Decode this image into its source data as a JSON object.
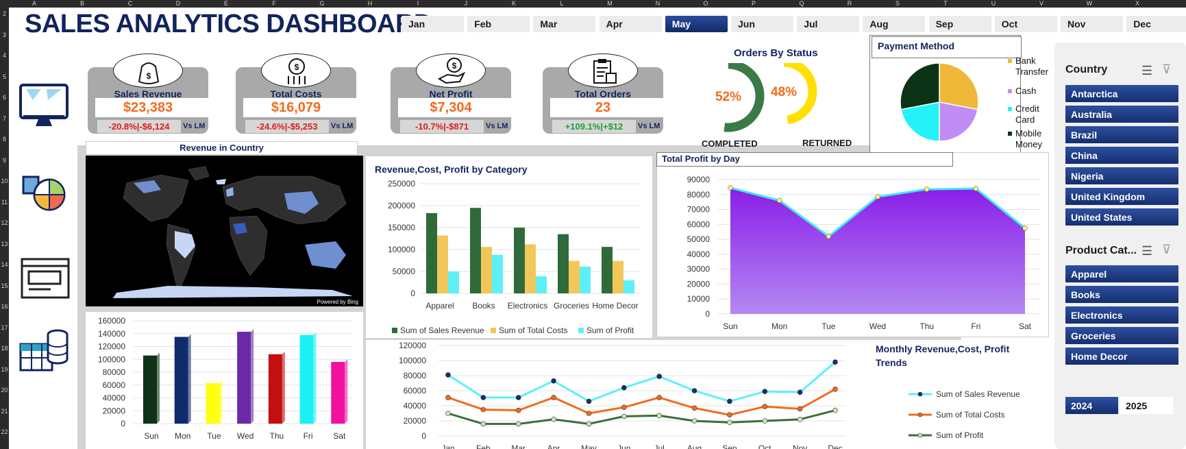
{
  "sheet": {
    "columns": [
      "A",
      "B",
      "C",
      "D",
      "E",
      "F",
      "G",
      "H",
      "I",
      "J",
      "K",
      "L",
      "M",
      "N",
      "O",
      "P",
      "Q",
      "R",
      "S",
      "T",
      "U",
      "V",
      "W",
      "X"
    ],
    "rows": [
      "2",
      "3",
      "4",
      "5",
      "6",
      "7",
      "8",
      "9",
      "10",
      "11",
      "12",
      "13",
      "14",
      "15",
      "16",
      "17",
      "18",
      "19",
      "20",
      "21",
      "22"
    ]
  },
  "title": "SALES ANALYTICS DASHBOARD",
  "months": [
    "Jan",
    "Feb",
    "Mar",
    "Apr",
    "May",
    "Jun",
    "Jul",
    "Aug",
    "Sep",
    "Oct",
    "Nov",
    "Dec"
  ],
  "selected_month": "May",
  "kpis": [
    {
      "label": "Sales Revenue",
      "value": "$23,383",
      "change": "-20.8%|-$6,124",
      "vs": "Vs LM",
      "trend": "neg",
      "icon": "money-bag-icon"
    },
    {
      "label": "Total Costs",
      "value": "$16,079",
      "change": "-24.6%|-$5,253",
      "vs": "Vs LM",
      "trend": "neg",
      "icon": "coin-down-icon"
    },
    {
      "label": "Net Profit",
      "value": "$7,304",
      "change": "-10.7%|-$871",
      "vs": "Vs LM",
      "trend": "neg",
      "icon": "hand-coin-icon"
    },
    {
      "label": "Total Orders",
      "value": "23",
      "change": "+109.1%|+$12",
      "vs": "Vs LM",
      "trend": "pos",
      "icon": "clipboard-box-icon"
    }
  ],
  "orders_status": {
    "title": "Orders By Status",
    "completed": {
      "pct": "52%",
      "label": "COMPLETED",
      "fraction": 0.52,
      "color": "#3a7a46"
    },
    "returned": {
      "pct": "48%",
      "label": "RETURNED",
      "fraction": 0.48,
      "color": "#ffe000"
    }
  },
  "payment": {
    "title": "Payment Method",
    "legend": [
      {
        "label": "Bank Transfer",
        "color": "#f0b838",
        "value": 0.28
      },
      {
        "label": "Cash",
        "color": "#c28cf5",
        "value": 0.22
      },
      {
        "label": "Credit Card",
        "color": "#25f2f8",
        "value": 0.22
      },
      {
        "label": "Mobile Money",
        "color": "#0c3315",
        "value": 0.28
      }
    ]
  },
  "map": {
    "title": "Revenue in Country",
    "credit": "Powered by Bing"
  },
  "category_chart": {
    "title": "Revenue,Cost, Profit by Category",
    "type": "bar",
    "categories": [
      "Apparel",
      "Books",
      "Electronics",
      "Groceries",
      "Home Decor"
    ],
    "series": [
      {
        "name": "Sum of Sales Revenue",
        "values": [
          183000,
          195000,
          150000,
          135000,
          106000
        ],
        "color": "#2f6b3a"
      },
      {
        "name": "Sum of Total Costs",
        "values": [
          132000,
          106000,
          112000,
          74000,
          74000
        ],
        "color": "#f2c75a"
      },
      {
        "name": "Sum of Profit",
        "values": [
          50000,
          88000,
          39000,
          61000,
          30000
        ],
        "color": "#5ef0f7"
      }
    ],
    "ylim": [
      0,
      250000
    ],
    "ticks": [
      "0",
      "50000",
      "100000",
      "150000",
      "200000",
      "250000"
    ]
  },
  "day_profit_chart": {
    "title": "Total Profit by Day",
    "type": "area",
    "x": [
      "Sun",
      "Mon",
      "Tue",
      "Wed",
      "Thu",
      "Fri",
      "Sat"
    ],
    "values": [
      84500,
      76000,
      52000,
      78500,
      83500,
      84000,
      57500
    ],
    "ylim": [
      0,
      90000
    ],
    "ticks": [
      "0",
      "10000",
      "20000",
      "30000",
      "40000",
      "50000",
      "60000",
      "70000",
      "80000",
      "90000"
    ]
  },
  "day_bar_chart": {
    "type": "bar",
    "x": [
      "Sun",
      "Mon",
      "Tue",
      "Wed",
      "Thu",
      "Fri",
      "Sat"
    ],
    "values": [
      106000,
      135000,
      63000,
      143000,
      108000,
      138000,
      96000
    ],
    "colors": [
      "#0e3318",
      "#0f2b6b",
      "#ffff10",
      "#6a2aa6",
      "#c21010",
      "#1cf0f5",
      "#f011a0"
    ],
    "ylim": [
      0,
      160000
    ],
    "ticks": [
      "0",
      "20000",
      "40000",
      "60000",
      "80000",
      "100000",
      "120000",
      "140000",
      "160000"
    ]
  },
  "monthly_chart": {
    "title": "Monthly Revenue,Cost, Profit Trends",
    "type": "line",
    "x": [
      "Jan",
      "Feb",
      "Mar",
      "Apr",
      "May",
      "Jun",
      "Jul",
      "Aug",
      "Sep",
      "Oct",
      "Nov",
      "Dec"
    ],
    "series": [
      {
        "name": "Sum of Sales Revenue",
        "values": [
          81000,
          51000,
          51000,
          73000,
          46000,
          64000,
          79000,
          60000,
          46000,
          59000,
          58000,
          98000
        ],
        "color": "#5ef0f7",
        "marker": "#1a2d6e"
      },
      {
        "name": "Sum of Total Costs",
        "values": [
          51000,
          35000,
          34000,
          51000,
          30000,
          38000,
          51000,
          37000,
          28000,
          39000,
          36000,
          62000
        ],
        "color": "#f26b1d",
        "marker": "#f26b1d"
      },
      {
        "name": "Sum of Profit",
        "values": [
          30000,
          16000,
          16000,
          22000,
          16000,
          26000,
          27000,
          20000,
          18000,
          20000,
          22000,
          34000
        ],
        "color": "#3a6e3a",
        "marker": "#c8e6b0"
      }
    ],
    "ylim": [
      0,
      120000
    ],
    "ticks": [
      "0",
      "20000",
      "40000",
      "60000",
      "80000",
      "100000",
      "120000"
    ]
  },
  "slicers": {
    "country": {
      "title": "Country",
      "items": [
        "Antarctica",
        "Australia",
        "Brazil",
        "China",
        "Nigeria",
        "United Kingdom",
        "United States"
      ]
    },
    "category": {
      "title": "Product Cat...",
      "items": [
        "Apparel",
        "Books",
        "Electronics",
        "Groceries",
        "Home Decor"
      ]
    },
    "years": [
      "2024",
      "2025"
    ],
    "selected_year": "2024"
  },
  "side_icons": [
    "monitor-icon",
    "report-icon",
    "window-icon",
    "database-table-icon"
  ]
}
